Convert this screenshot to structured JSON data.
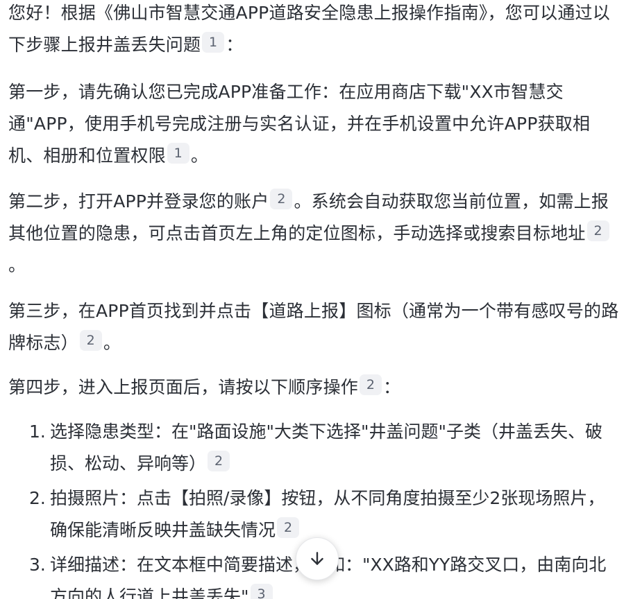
{
  "intro": {
    "text": "您好！根据《佛山市智慧交通APP道路安全隐患上报操作指南》，您可以通过以下步骤上报井盖丢失问题",
    "cite": "1",
    "tail": "："
  },
  "step1": {
    "text": "第一步，请先确认您已完成APP准备工作：在应用商店下载\"XX市智慧交通\"APP，使用手机号完成注册与实名认证，并在手机设置中允许APP获取相机、相册和位置权限",
    "cite": "1",
    "tail": "。"
  },
  "step2": {
    "text_a": "第二步，打开APP并登录您的账户",
    "cite_a": "2",
    "text_b": "。系统会自动获取您当前位置，如需上报其他位置的隐患，可点击首页左上角的定位图标，手动选择或搜索目标地址",
    "cite_b": "2",
    "tail": "。"
  },
  "step3": {
    "text": "第三步，在APP首页找到并点击【道路上报】图标（通常为一个带有感叹号的路牌标志）",
    "cite": "2",
    "tail": "。"
  },
  "step4": {
    "text": "第四步，进入上报页面后，请按以下顺序操作",
    "cite": "2",
    "tail": "："
  },
  "list": [
    {
      "num": "1.",
      "text": "选择隐患类型：在\"路面设施\"大类下选择\"井盖问题\"子类（井盖丢失、破损、松动、异响等）",
      "cite": "2"
    },
    {
      "num": "2.",
      "text": "拍摄照片：点击【拍照/录像】按钮，从不同角度拍摄至少2张现场照片，确保能清晰反映井盖缺失情况",
      "cite": "2"
    },
    {
      "num": "3.",
      "text": "详细描述：在文本框中简要描述，例如：\"XX路和YY路交叉口，由南向北方向的人行道上井盖丢失\"",
      "cite": "3"
    }
  ],
  "icons": {
    "scroll_down": "arrow-down-icon"
  }
}
